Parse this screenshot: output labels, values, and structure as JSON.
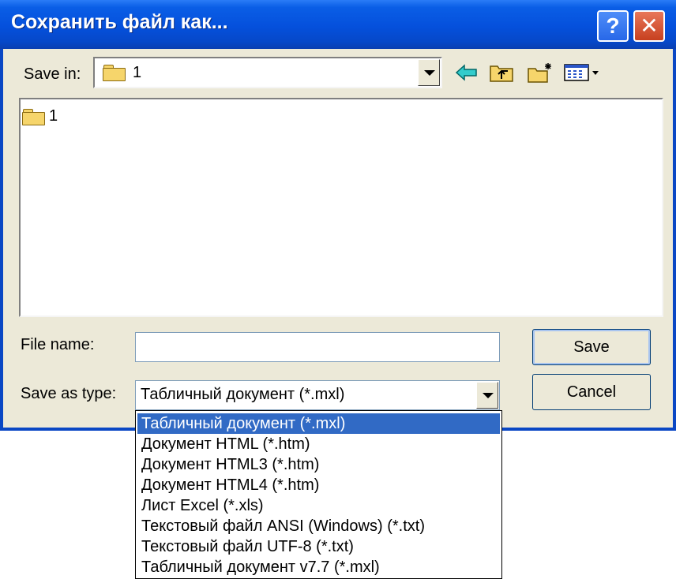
{
  "window": {
    "title": "Сохранить файл как..."
  },
  "title_buttons": {
    "help": "?",
    "close": "✕"
  },
  "toolbar": {
    "save_in_label": "Save in:",
    "save_in_value": "1",
    "icons": [
      "back-arrow-icon",
      "up-folder-icon",
      "new-folder-icon",
      "view-menu-icon"
    ]
  },
  "file_list": {
    "items": [
      {
        "name": "1",
        "icon": "folder-icon"
      }
    ]
  },
  "form": {
    "file_name_label": "File name:",
    "file_name_value": "",
    "save_as_type_label": "Save as type:",
    "save_as_type_value": "Табличный документ (*.mxl)"
  },
  "buttons": {
    "save": "Save",
    "cancel": "Cancel"
  },
  "type_options": [
    "Табличный документ (*.mxl)",
    "Документ HTML (*.htm)",
    "Документ HTML3 (*.htm)",
    "Документ HTML4 (*.htm)",
    "Лист Excel (*.xls)",
    "Текстовый файл ANSI (Windows) (*.txt)",
    "Текстовый файл UTF-8 (*.txt)",
    "Табличный документ v7.7 (*.mxl)"
  ],
  "selected_option_index": 0,
  "colors": {
    "titlebar": "#0550dc",
    "selection": "#316ac5",
    "dialog_bg": "#ece9d8",
    "folder": "#f6d56b"
  }
}
